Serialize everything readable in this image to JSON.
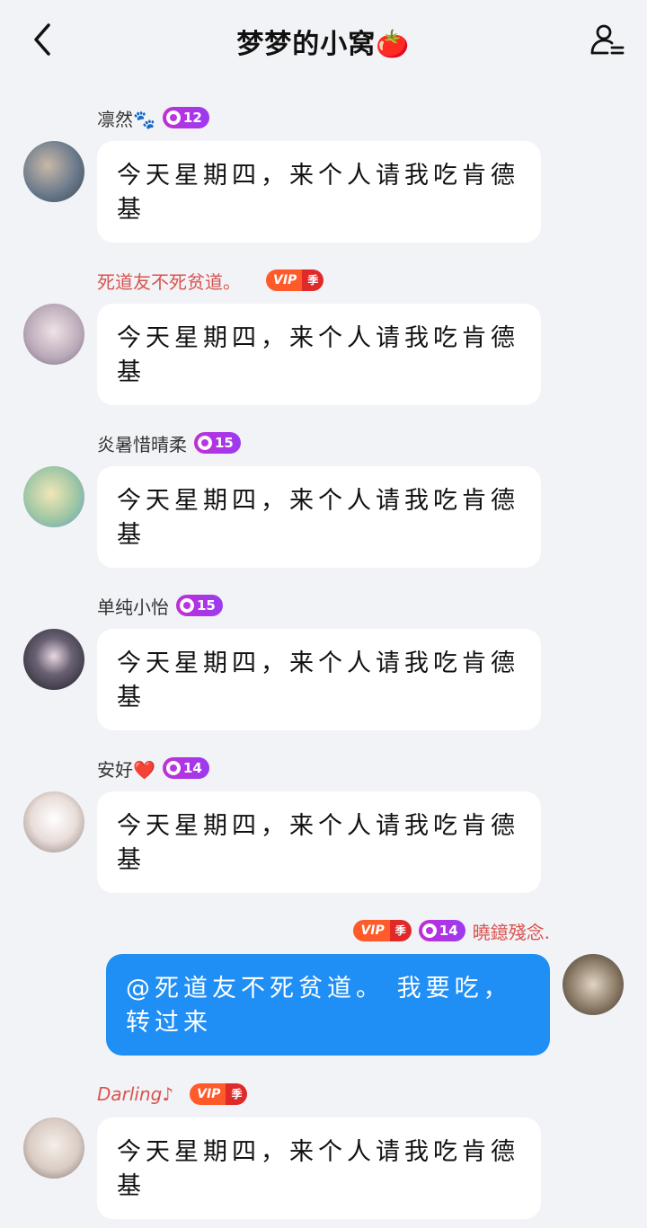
{
  "header": {
    "title": "梦梦的小窝🍅"
  },
  "messages": [
    {
      "name": "凛然🐾",
      "level": "12",
      "vip": false,
      "text": "今天星期四，来个人请我吃肯德基",
      "side": "left",
      "avatar_color": "#6b7b8c"
    },
    {
      "name": "死道友不死贫道。",
      "level": "",
      "vip": true,
      "text": "今天星期四，来个人请我吃肯德基",
      "side": "left",
      "avatar_color": "#b9a9b8"
    },
    {
      "name": "炎暑惜晴柔",
      "level": "15",
      "vip": false,
      "text": "今天星期四，来个人请我吃肯德基",
      "side": "left",
      "avatar_color": "#9fc7a4"
    },
    {
      "name": "单纯小怡",
      "level": "15",
      "vip": false,
      "text": "今天星期四，来个人请我吃肯德基",
      "side": "left",
      "avatar_color": "#2a2a33"
    },
    {
      "name": "安好❤️",
      "level": "14",
      "vip": false,
      "text": "今天星期四，来个人请我吃肯德基",
      "side": "left",
      "avatar_color": "#e8ddd9"
    },
    {
      "name": "曉鐿殘念.",
      "level": "14",
      "vip": true,
      "text": "@死道友不死贫道。 我要吃，转过来",
      "side": "right",
      "avatar_color": "#8a7a66"
    },
    {
      "name": "Darling♪",
      "level": "",
      "vip": true,
      "text": "今天星期四，来个人请我吃肯德基",
      "side": "left",
      "avatar_color": "#d9ccc4"
    }
  ],
  "badges": {
    "vip_label": "VIP",
    "vip_season": "季"
  },
  "icons": {
    "back": "chevron-left-icon",
    "profile": "group-members-icon"
  },
  "colors": {
    "background": "#f2f3f7",
    "self_bubble": "#1f8ef5",
    "vip_orange": "#ff5a2a",
    "level_purple": "#b836e0",
    "name_red": "#d9534f"
  }
}
